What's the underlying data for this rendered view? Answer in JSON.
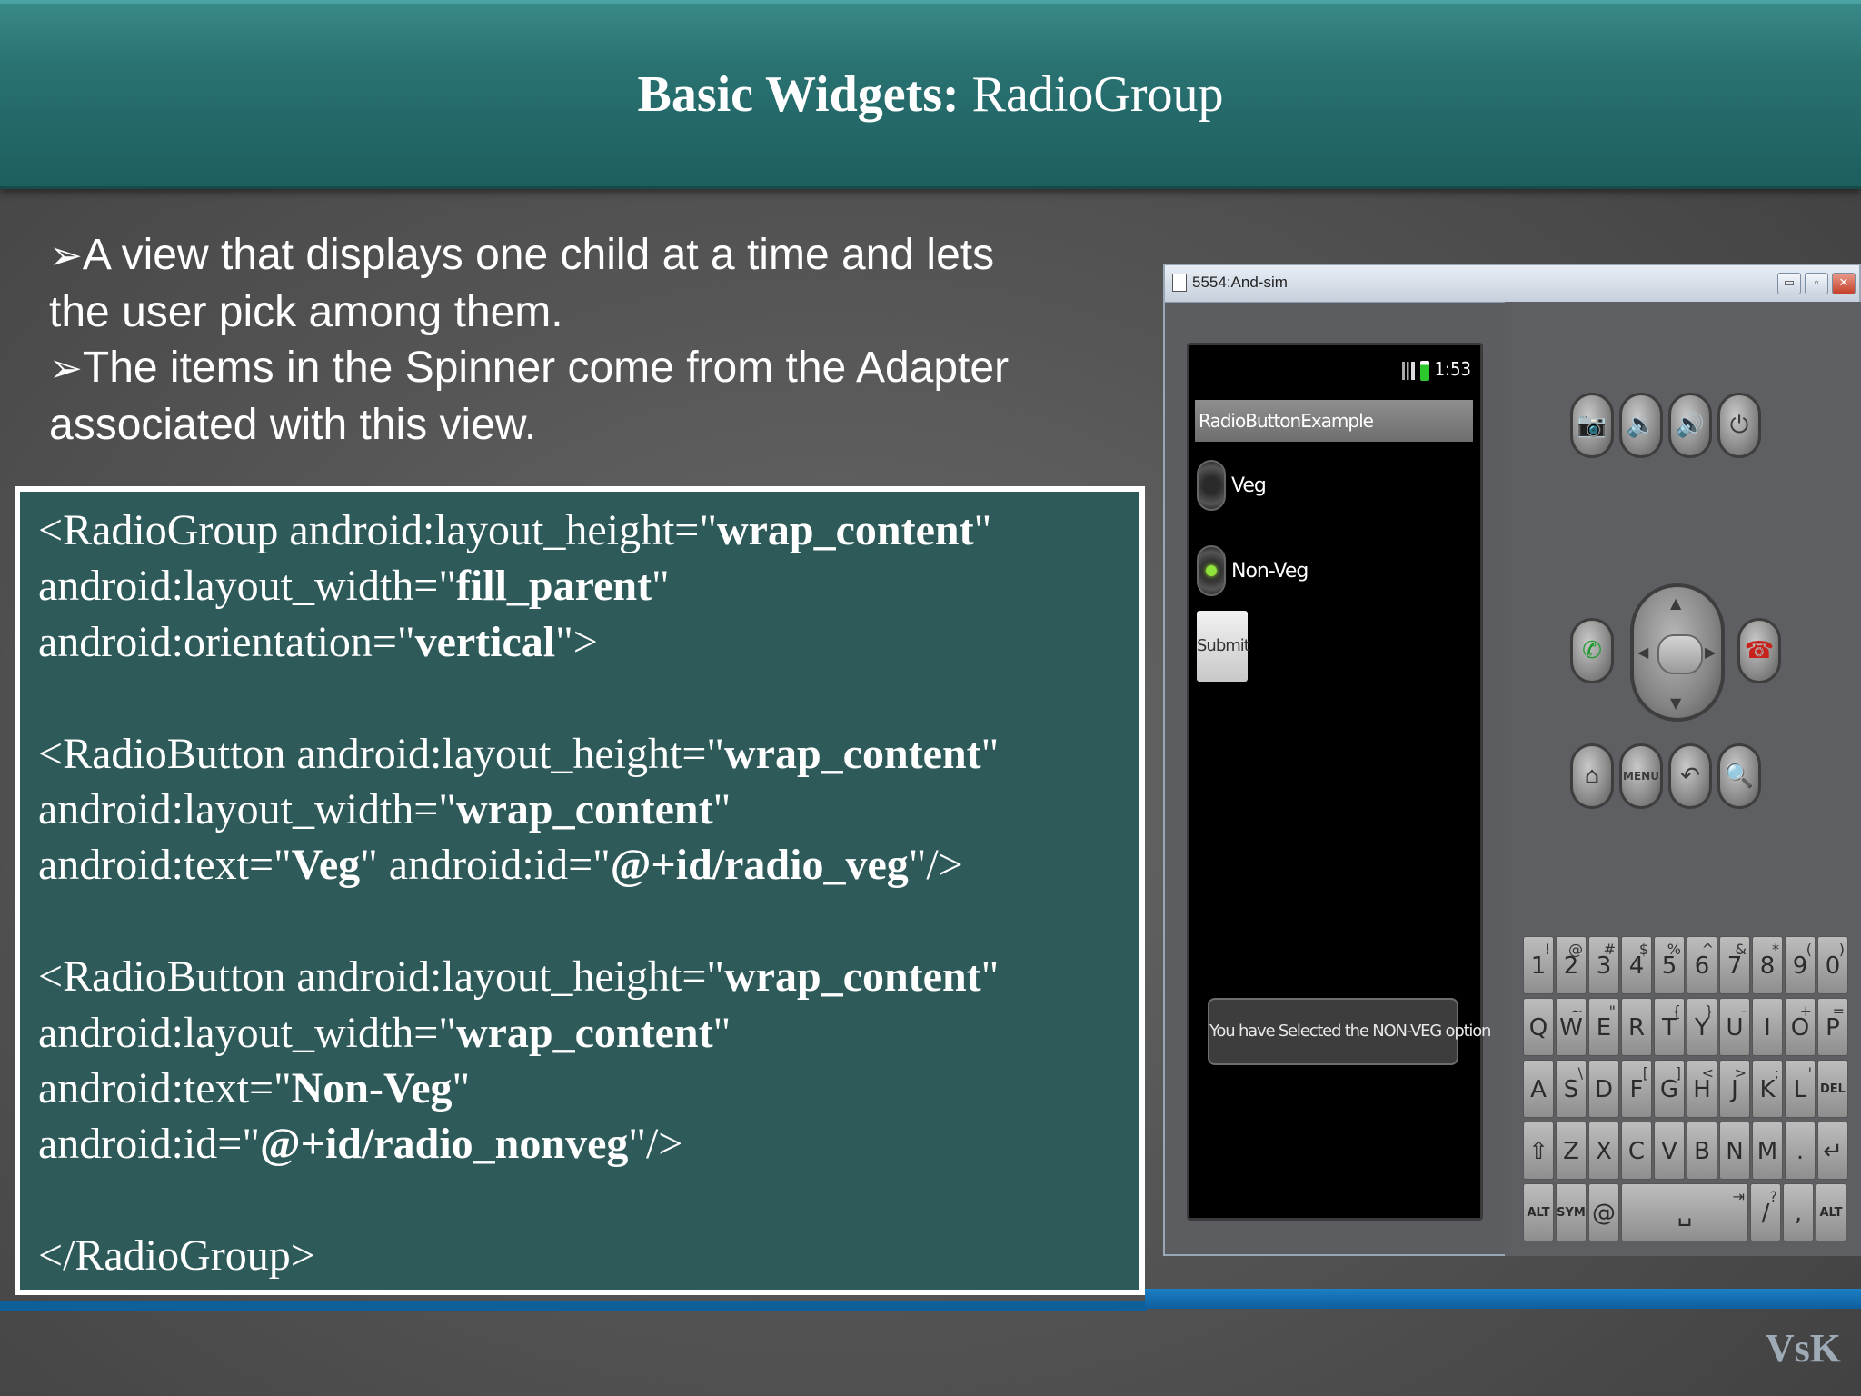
{
  "slide": {
    "title_bold": "Basic Widgets:",
    "title_regular": " RadioGroup",
    "bullets": [
      {
        "arrow": "➢",
        "line1": "A view that displays one child at a time and lets",
        "line2": "the user pick among them."
      },
      {
        "arrow": "➢",
        "line1": "The items in the Spinner come from the Adapter",
        "line2": "associated with this view."
      }
    ],
    "logo": "VsK"
  },
  "code": {
    "l1": {
      "a": "<RadioGroup android:layout_height=\"",
      "b": "wrap_content",
      "c": "\""
    },
    "l2": {
      "a": "android:layout_width=\"",
      "b": "fill_parent",
      "c": "\""
    },
    "l3": {
      "a": "android:orientation=\"",
      "b": "vertical",
      "c": "\">"
    },
    "l5": {
      "a": "<RadioButton android:layout_height=\"",
      "b": "wrap_content",
      "c": "\""
    },
    "l6": {
      "a": "android:layout_width=\"",
      "b": "wrap_content",
      "c": "\""
    },
    "l7": {
      "a": "android:text=\"",
      "b": "Veg",
      "c": "\" android:id=\"",
      "d": "@+id/radio_veg",
      "e": "\"/>"
    },
    "l9": {
      "a": "<RadioButton android:layout_height=\"",
      "b": "wrap_content",
      "c": "\""
    },
    "l10": {
      "a": "android:layout_width=\"",
      "b": "wrap_content",
      "c": "\""
    },
    "l11": {
      "a": "android:text=\"",
      "b": "Non-Veg",
      "c": "\""
    },
    "l12": {
      "a": "android:id=\"",
      "b": "@+id/radio_nonveg",
      "c": "\"/>"
    },
    "l14": {
      "a": "</RadioGroup>"
    }
  },
  "emulator": {
    "window_title": "5554:And-sim",
    "window_buttons": {
      "minimize": "▭",
      "maximize": "▫",
      "close": "✕"
    },
    "status_time": "1:53",
    "app_title": "RadioButtonExample",
    "radio_veg": "Veg",
    "radio_nonveg": "Non-Veg",
    "radio_checked": "Non-Veg",
    "submit": "Submit",
    "toast": "You have Selected the NON-VEG option",
    "hw_buttons": {
      "camera": "📷",
      "vol_down": "🔉",
      "vol_up": "🔊",
      "power": "⏻",
      "call": "✆",
      "end_call": "☎",
      "home": "⌂",
      "menu": "MENU",
      "back": "↶",
      "search": "🔍"
    },
    "keyboard": {
      "row1": [
        [
          "1",
          "!"
        ],
        [
          "2",
          "@"
        ],
        [
          "3",
          "#"
        ],
        [
          "4",
          "$"
        ],
        [
          "5",
          "%"
        ],
        [
          "6",
          "^"
        ],
        [
          "7",
          "&"
        ],
        [
          "8",
          "*"
        ],
        [
          "9",
          "("
        ],
        [
          "0",
          ")"
        ]
      ],
      "row2": [
        [
          "Q",
          ""
        ],
        [
          "W",
          "~"
        ],
        [
          "E",
          "\""
        ],
        [
          "R",
          ""
        ],
        [
          "T",
          "{"
        ],
        [
          "Y",
          "}"
        ],
        [
          "U",
          "-"
        ],
        [
          "I",
          ""
        ],
        [
          "O",
          "+"
        ],
        [
          "P",
          "="
        ]
      ],
      "row3": [
        [
          "A",
          ""
        ],
        [
          "S",
          "\\"
        ],
        [
          "D",
          ""
        ],
        [
          "F",
          "["
        ],
        [
          "G",
          "]"
        ],
        [
          "H",
          "<"
        ],
        [
          "J",
          ">"
        ],
        [
          "K",
          ";"
        ],
        [
          "L",
          "'"
        ],
        [
          "DEL",
          ""
        ]
      ],
      "row4": [
        [
          "⇧",
          ""
        ],
        [
          "Z",
          ""
        ],
        [
          "X",
          ""
        ],
        [
          "C",
          ""
        ],
        [
          "V",
          ""
        ],
        [
          "B",
          ""
        ],
        [
          "N",
          ""
        ],
        [
          "M",
          ""
        ],
        [
          ".",
          ""
        ],
        [
          "↵",
          ""
        ]
      ],
      "row5": [
        [
          "ALT",
          ""
        ],
        [
          "SYM",
          ""
        ],
        [
          "@",
          ""
        ],
        [
          "␣",
          "⇥"
        ],
        [
          "/",
          "?"
        ],
        [
          ",",
          ""
        ],
        [
          "ALT",
          ""
        ]
      ]
    }
  }
}
